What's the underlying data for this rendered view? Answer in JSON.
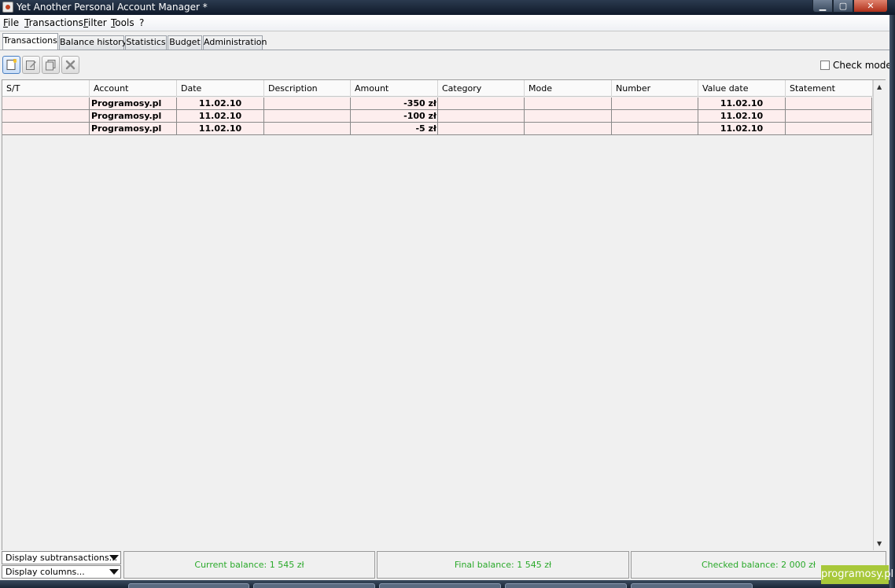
{
  "window": {
    "title": "Yet Another Personal Account Manager *",
    "controls": {
      "minimize": "▁",
      "maximize": "▢",
      "close": "✕"
    }
  },
  "menubar": {
    "items": [
      "File",
      "Transactions",
      "Filter",
      "Tools",
      "?"
    ]
  },
  "tabs": [
    {
      "label": "Transactions",
      "active": true
    },
    {
      "label": "Balance history",
      "active": false
    },
    {
      "label": "Statistics",
      "active": false
    },
    {
      "label": "Budget",
      "active": false
    },
    {
      "label": "Administration",
      "active": false
    }
  ],
  "toolbar": {
    "icons": [
      "new-transaction-icon",
      "edit-transaction-icon",
      "copy-transaction-icon",
      "delete-transaction-icon"
    ],
    "check_mode_label": "Check mode",
    "check_mode_checked": false
  },
  "table": {
    "columns": [
      "S/T",
      "Account",
      "Date",
      "Description",
      "Amount",
      "Category",
      "Mode",
      "Number",
      "Value date",
      "Statement"
    ],
    "rows": [
      {
        "st": "",
        "account": "Programosy.pl",
        "date": "11.02.10",
        "description": "",
        "amount": "-350 zł",
        "category": "",
        "mode": "",
        "number": "",
        "value_date": "11.02.10",
        "statement": ""
      },
      {
        "st": "",
        "account": "Programosy.pl",
        "date": "11.02.10",
        "description": "",
        "amount": "-100 zł",
        "category": "",
        "mode": "",
        "number": "",
        "value_date": "11.02.10",
        "statement": ""
      },
      {
        "st": "",
        "account": "Programosy.pl",
        "date": "11.02.10",
        "description": "",
        "amount": "-5 zł",
        "category": "",
        "mode": "",
        "number": "",
        "value_date": "11.02.10",
        "statement": ""
      }
    ],
    "row_color": "#fdeeee"
  },
  "statusbar": {
    "display_subtransactions": "Display subtransactions...",
    "display_columns": "Display columns...",
    "current_balance": "Current balance: 1 545 zł",
    "final_balance": "Final balance: 1 545 zł",
    "checked_balance": "Checked balance: 2 000 zł",
    "balance_color": "#2aa92a"
  },
  "watermark": "programosy.pl"
}
